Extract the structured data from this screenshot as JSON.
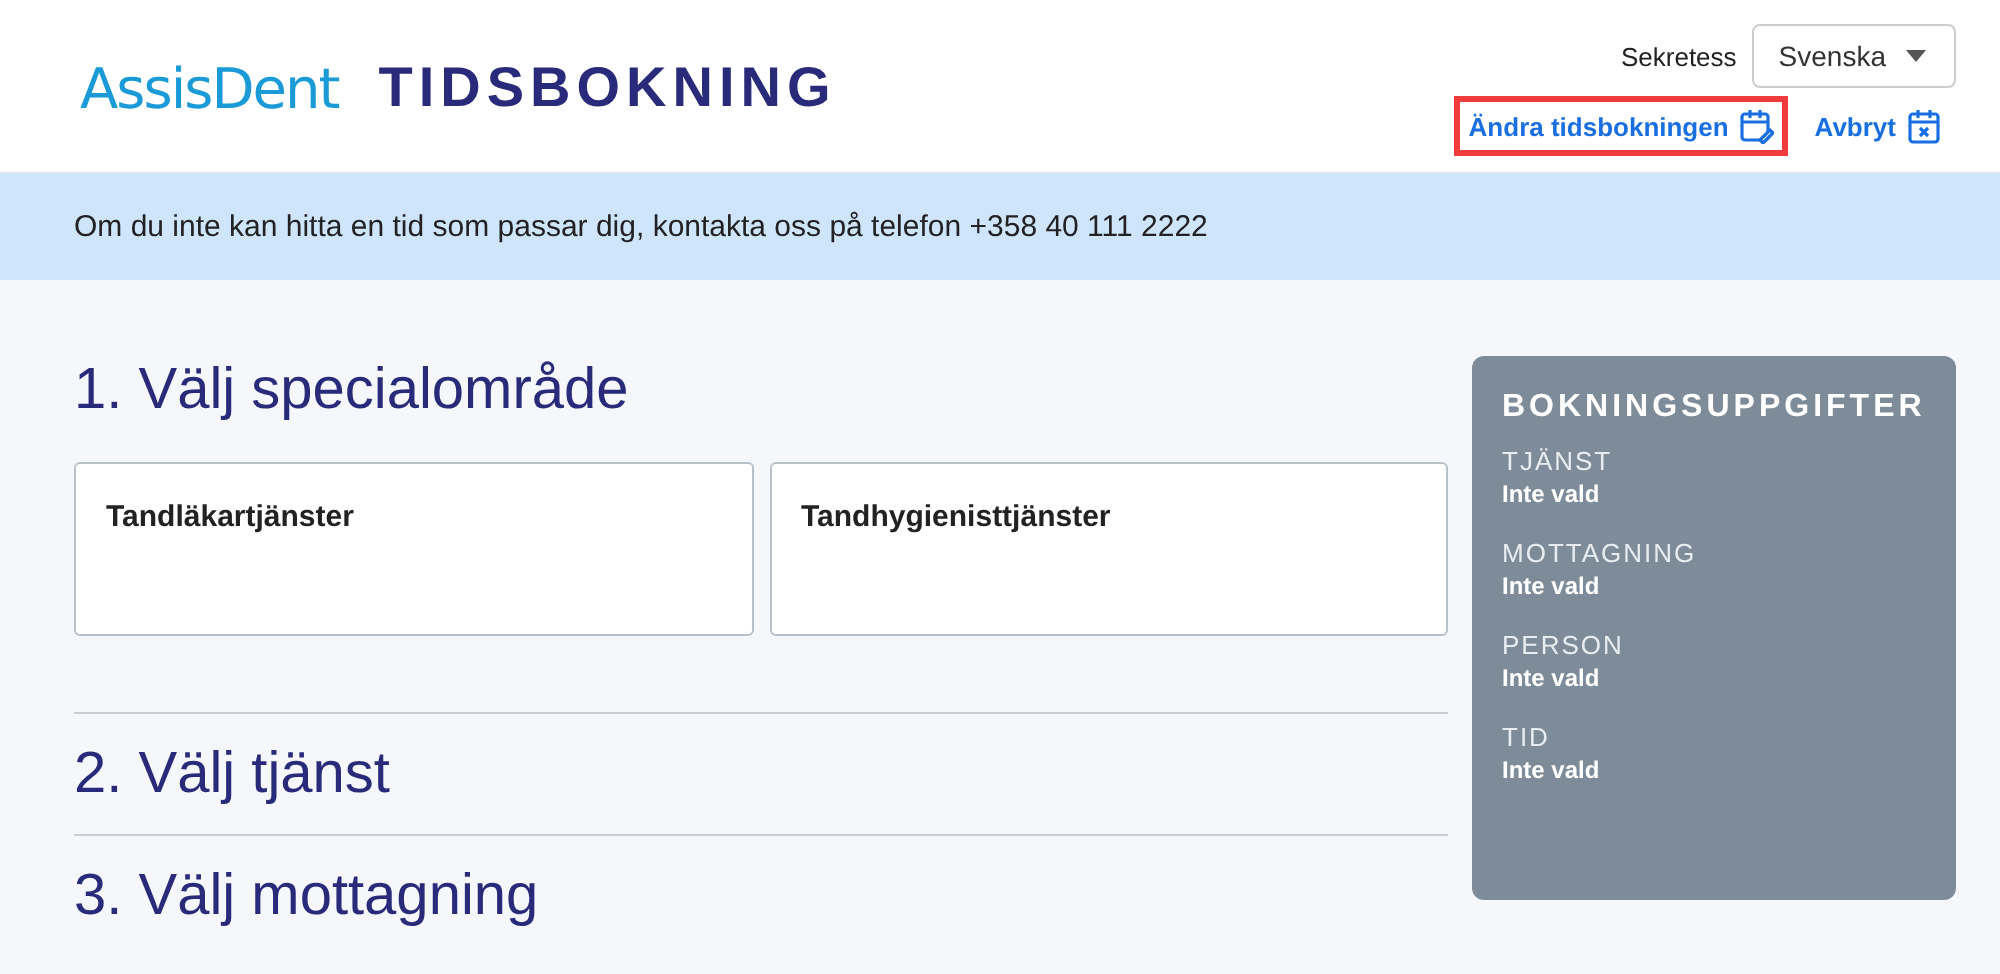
{
  "header": {
    "logo": "AssisDent",
    "title": "TIDSBOKNING",
    "privacy_link": "Sekretess",
    "language": "Svenska",
    "actions": [
      {
        "label": "Ändra tidsbokningen",
        "kind": "edit",
        "highlighted": true
      },
      {
        "label": "Avbryt",
        "kind": "cancel",
        "highlighted": false
      }
    ]
  },
  "notice": "Om du inte kan hitta en tid som passar dig, kontakta oss på telefon +358 40 111 2222",
  "steps": [
    {
      "title": "1. Välj specialområde",
      "options": [
        "Tandläkartjänster",
        "Tandhygienisttjänster"
      ]
    },
    {
      "title": "2. Välj tjänst"
    },
    {
      "title": "3. Välj mottagning"
    }
  ],
  "summary": {
    "title": "BOKNINGSUPPGIFTER",
    "items": [
      {
        "label": "TJÄNST",
        "value": "Inte vald"
      },
      {
        "label": "MOTTAGNING",
        "value": "Inte vald"
      },
      {
        "label": "PERSON",
        "value": "Inte vald"
      },
      {
        "label": "TID",
        "value": "Inte vald"
      }
    ]
  }
}
